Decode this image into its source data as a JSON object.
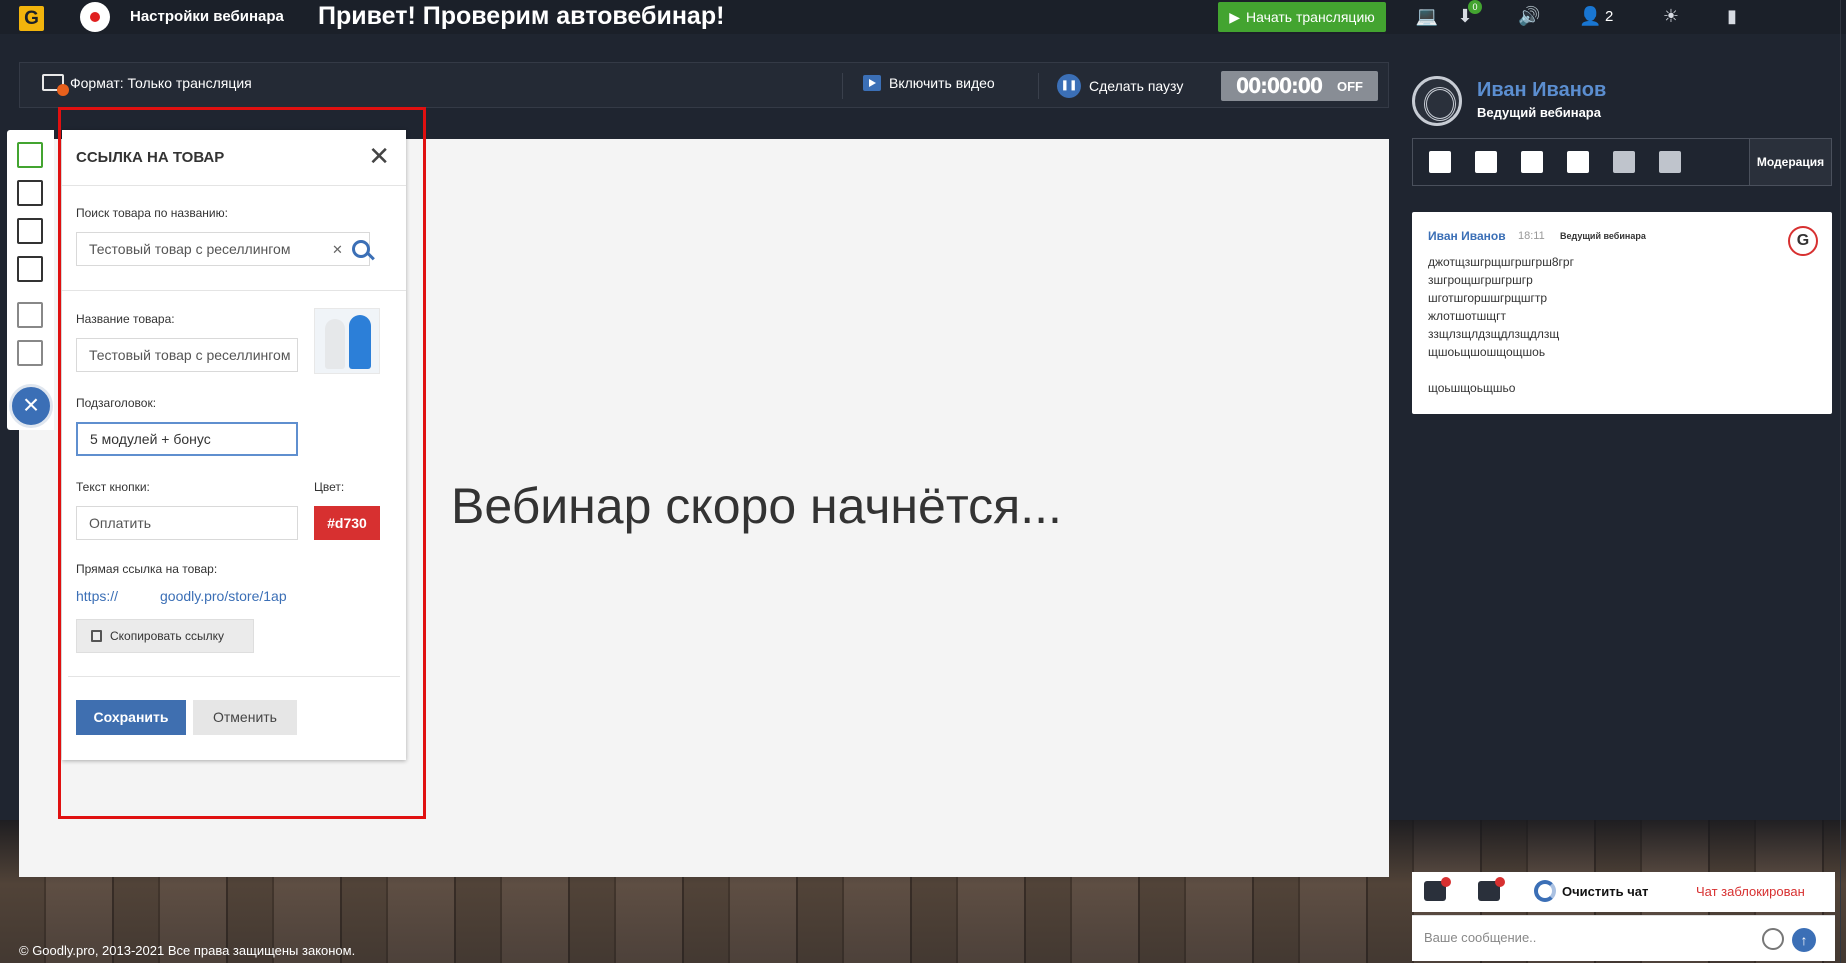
{
  "topbar": {
    "logo_letter": "G",
    "settings_label": "Настройки вебинара",
    "title": "Привет! Проверим автовебинар!",
    "start_button": "Начать трансляцию",
    "notification_count": "0",
    "viewers_count": "2",
    "icons": [
      "laptop-icon",
      "download-icon",
      "volume-icon",
      "user-icon",
      "weather-icon",
      "exit-door-icon"
    ]
  },
  "controls": {
    "format_label": "Формат: Только трансляция",
    "video_button": "Включить видео",
    "pause_button": "Сделать паузу",
    "timer": "00:00:00",
    "timer_state": "OFF"
  },
  "stage": {
    "message": "Вебинар скоро начнётся...",
    "footer": "© Goodly.pro, 2013-2021 Все права защищены законом."
  },
  "product_panel": {
    "title": "ССЫЛКА НА ТОВАР",
    "search_label": "Поиск товара по названию:",
    "search_value": "Тестовый товар с реселлингом",
    "name_label": "Название товара:",
    "name_value": "Тестовый товар с реселлингом",
    "subtitle_label": "Подзаголовок:",
    "subtitle_value": "5 модулей + бонус",
    "button_text_label": "Текст кнопки:",
    "button_text_value": "Оплатить",
    "color_label": "Цвет:",
    "color_value": "#d730",
    "link_label": "Прямая ссылка на товар:",
    "link_prefix": "https://",
    "link_suffix": "goodly.pro/store/1ap",
    "copy_button": "Скопировать ссылку",
    "save_button": "Сохранить",
    "cancel_button": "Отменить"
  },
  "host": {
    "name": "Иван Иванов",
    "role": "Ведущий вебинара"
  },
  "tools_strip": {
    "moderation": "Модерация",
    "icons": [
      "add-page-icon",
      "note-icon",
      "image-icon",
      "ruler-icon",
      "split-icon",
      "question-icon"
    ]
  },
  "chat": {
    "message": {
      "author": "Иван Иванов",
      "time": "18:11",
      "role": "Ведущий вебинара",
      "badge": "G",
      "lines": [
        "джотщзшгрщшгршгрш8грг",
        "зшгрощшгршгршгр",
        "шготшгоршшгрщшгтр",
        "жлотшотшщгт",
        "ззщлзщлдзщдлзщдлзщ",
        "щшоьщшошщощшоь",
        "",
        "щоьшщоьщшьо"
      ]
    },
    "clear_chat": "Очистить чат",
    "chat_locked": "Чат заблокирован",
    "input_placeholder": "Ваше сообщение.."
  },
  "colors": {
    "accent_blue": "#3b6fb6",
    "start_green": "#43a430",
    "product_red": "#d73030",
    "highlight_frame": "#e01010"
  }
}
